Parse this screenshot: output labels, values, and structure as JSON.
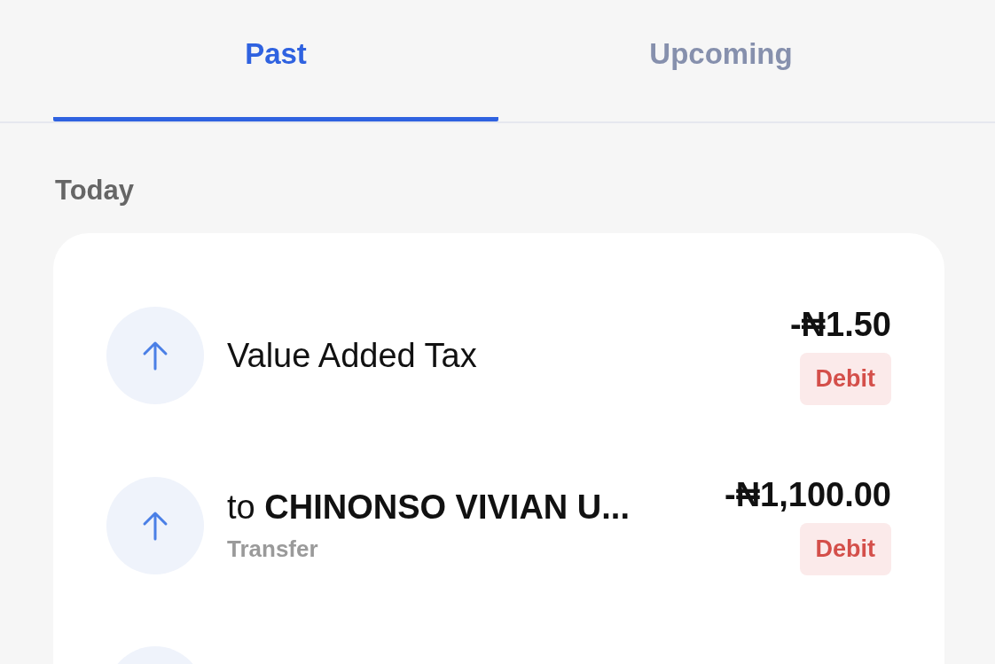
{
  "tabs": [
    {
      "label": "Past",
      "selected": true
    },
    {
      "label": "Upcoming",
      "selected": false
    }
  ],
  "section": "Today",
  "transactions": [
    {
      "kind": "full",
      "title": "Value Added Tax",
      "amount": "-₦1.50",
      "badge": "Debit"
    },
    {
      "kind": "full",
      "title": "to **CHINONSO VIVIAN U...**",
      "subtitle": "Transfer",
      "amount": "-₦1,100.00",
      "badge": "Debit"
    },
    {
      "kind": "cut"
    }
  ]
}
